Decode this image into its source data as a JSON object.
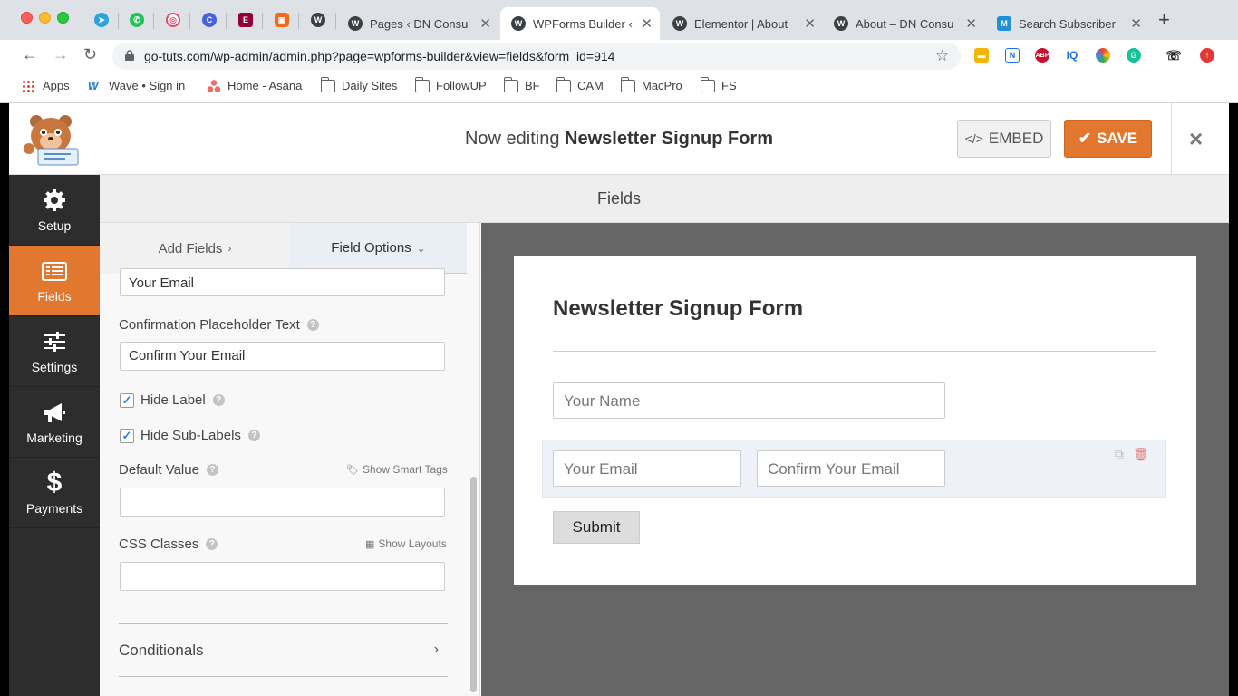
{
  "browser": {
    "tabs": [
      {
        "title": "Pages ‹ DN Consu",
        "favicon": "wordpress-icon"
      },
      {
        "title": "WPForms Builder ‹",
        "favicon": "wordpress-icon",
        "active": true
      },
      {
        "title": "Elementor | About",
        "favicon": "wordpress-icon"
      },
      {
        "title": "About – DN Consu",
        "favicon": "wordpress-icon"
      },
      {
        "title": "Search Subscriber",
        "favicon": "mailerlite-icon"
      }
    ],
    "url": "go-tuts.com/wp-admin/admin.php?page=wpforms-builder&view=fields&form_id=914",
    "bookmarks": [
      {
        "label": "Apps",
        "icon": "apps-grid-icon"
      },
      {
        "label": "Wave • Sign in",
        "icon": "wave-icon"
      },
      {
        "label": "Home - Asana",
        "icon": "asana-icon"
      },
      {
        "label": "Daily Sites",
        "icon": "folder-icon"
      },
      {
        "label": "FollowUP",
        "icon": "folder-icon"
      },
      {
        "label": "BF",
        "icon": "folder-icon"
      },
      {
        "label": "CAM",
        "icon": "folder-icon"
      },
      {
        "label": "MacPro",
        "icon": "folder-icon"
      },
      {
        "label": "FS",
        "icon": "folder-icon"
      }
    ],
    "extension_labels": [
      "N",
      "ABP",
      "IQ"
    ]
  },
  "header": {
    "editing_prefix": "Now editing",
    "form_name": "Newsletter Signup Form",
    "embed_label": "EMBED",
    "save_label": "SAVE",
    "close_icon": "×"
  },
  "sidebar": {
    "items": [
      {
        "label": "Setup",
        "icon": "gear-icon"
      },
      {
        "label": "Fields",
        "icon": "list-icon",
        "active": true
      },
      {
        "label": "Settings",
        "icon": "sliders-icon"
      },
      {
        "label": "Marketing",
        "icon": "megaphone-icon"
      },
      {
        "label": "Payments",
        "icon": "dollar-icon"
      }
    ]
  },
  "panel": {
    "title": "Fields",
    "tab_add": "Add Fields",
    "tab_options": "Field Options"
  },
  "options": {
    "top_input_value": "Your Email",
    "confirm_placeholder_label": "Confirmation Placeholder Text",
    "confirm_placeholder_value": "Confirm Your Email",
    "hide_label": "Hide Label",
    "hide_label_checked": true,
    "hide_sublabels": "Hide Sub-Labels",
    "hide_sublabels_checked": true,
    "default_value_label": "Default Value",
    "show_smart_tags": "Show Smart Tags",
    "css_classes_label": "CSS Classes",
    "show_layouts": "Show Layouts",
    "conditionals": "Conditionals"
  },
  "preview": {
    "form_title": "Newsletter Signup Form",
    "name_placeholder": "Your Name",
    "email_placeholder": "Your Email",
    "confirm_placeholder": "Confirm Your Email",
    "submit_label": "Submit"
  },
  "colors": {
    "accent": "#e27730",
    "sidebar_bg": "#2d2d2d",
    "preview_bg": "#666666"
  }
}
